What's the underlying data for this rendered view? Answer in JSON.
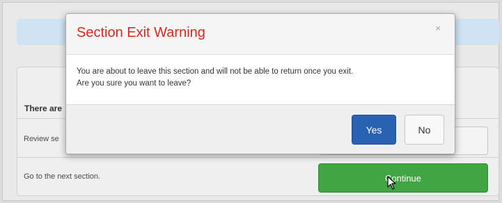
{
  "background": {
    "panel_heading": "There are",
    "rows": [
      {
        "text": "Review se"
      },
      {
        "text": "Go to the next section.",
        "button_label": "Continue"
      }
    ]
  },
  "modal": {
    "title": "Section Exit Warning",
    "close_glyph": "×",
    "body_line1": "You are about to leave this section and will not be able to return once you exit.",
    "body_line2": "Are you sure you want to leave?",
    "yes_label": "Yes",
    "no_label": "No"
  },
  "colors": {
    "title_red": "#e0251c",
    "yes_blue": "#2a62b3",
    "continue_green": "#41a544"
  }
}
